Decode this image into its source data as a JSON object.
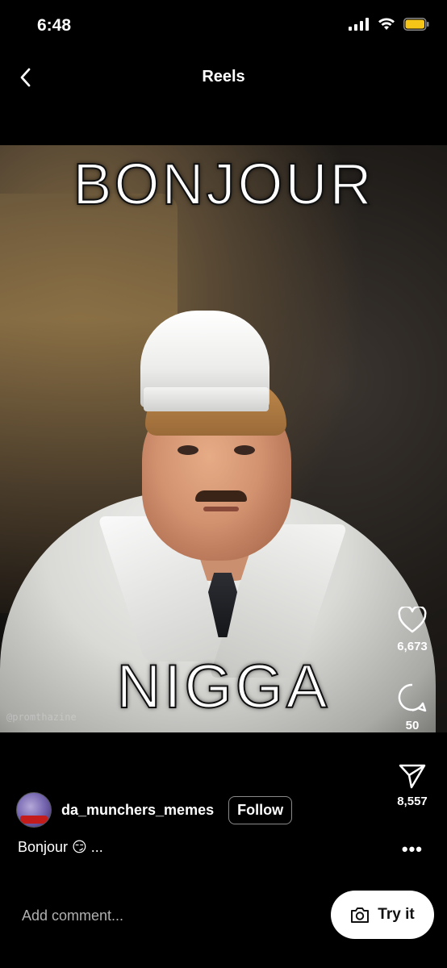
{
  "status_bar": {
    "time": "6:48",
    "icons": [
      "cellular-signal-icon",
      "wifi-icon",
      "battery-icon"
    ],
    "battery_color": "#F5C518"
  },
  "header": {
    "title": "Reels",
    "back_icon": "chevron-left-icon"
  },
  "media": {
    "caption_top": "BONJOUR",
    "caption_bottom": "NIGGA",
    "watermark": "@promthazine"
  },
  "actions": {
    "likes": "6,673",
    "comments": "50",
    "shares": "8,557"
  },
  "post": {
    "username": "da_munchers_memes",
    "follow_label": "Follow",
    "caption": "Bonjour 😏  ...",
    "more_label": "•••"
  },
  "bottom": {
    "comment_placeholder": "Add comment...",
    "try_label": "Try it"
  }
}
